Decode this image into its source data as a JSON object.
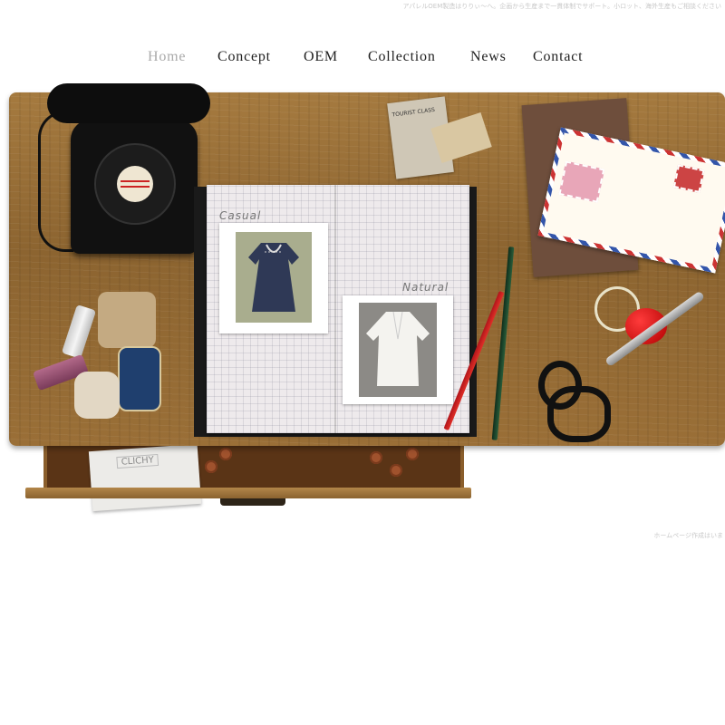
{
  "header": {
    "tagline": "アパレルOEM製造はりりぃ〜へ。企画から生産まで一貫体制でサポート。小ロット、海外生産もご相談ください"
  },
  "nav": {
    "items": [
      {
        "label": "Home",
        "active": true
      },
      {
        "label": "Concept",
        "active": false
      },
      {
        "label": "OEM",
        "active": false
      },
      {
        "label": "Collection",
        "active": false
      },
      {
        "label": "News",
        "active": false
      },
      {
        "label": "Contact",
        "active": false
      }
    ]
  },
  "desk": {
    "notebook": {
      "left_label": "Casual",
      "right_label": "Natural"
    },
    "tag": {
      "text": "TOURIST CLASS"
    },
    "coaster": {
      "text": "CLICHY"
    }
  },
  "footer": {
    "text": "ホームページ作成はいま"
  },
  "colors": {
    "nav_active": "#aaaaaa",
    "nav_text": "#222222",
    "desk_wood": "#9a6f37"
  }
}
